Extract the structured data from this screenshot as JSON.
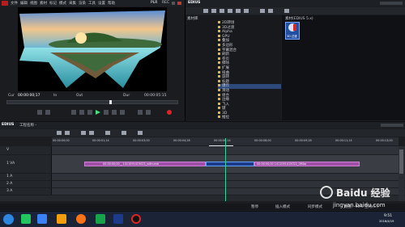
{
  "player": {
    "menu": [
      "文件",
      "编辑",
      "视图",
      "素材",
      "标记",
      "模式",
      "采集",
      "渲染",
      "工具",
      "设置",
      "帮助"
    ],
    "plr_label": "PLR",
    "rec_label": "REC",
    "cur_timecode": "00:00:00;17",
    "in_label": "In",
    "out_label": "Out",
    "dur_label": "Dur",
    "dur_value": "00:00:05:15"
  },
  "bin": {
    "title": "EDIUS",
    "tab": "素材库",
    "tree_items": [
      "2D转场",
      "3D过渡",
      "Alpha",
      "GPU",
      "叠加",
      "多边形",
      "字幕混合",
      "刷新",
      "卷页",
      "擦除",
      "扩展",
      "扭曲",
      "旋转",
      "标题",
      "爆炸",
      "滑动",
      "组合",
      "边缘",
      "飞入",
      "键",
      "3D",
      "推拉",
      "翻转",
      "选择"
    ],
    "thumb_title": "素材(EDIUS 5.x)",
    "thumb_label": "3D 过渡"
  },
  "timeline": {
    "title": "EDIUS",
    "seq_name": "工程名称 - ",
    "ruler": [
      "00:00:00;00",
      "00:00:01;14",
      "00:00:03;00",
      "00:00:04;28",
      "00:00:06;14",
      "00:00:08;00",
      "00:00:09;28",
      "00:00:11;14",
      "00:00:13;00"
    ],
    "playhead_time": "00:00:07;24",
    "tracks": [
      "V",
      "1 VA",
      "1 A",
      "2 A",
      "3 A"
    ],
    "clip_a": "00:00:00;00 _ 1411091415023_withumb",
    "clip_b": "00:00:00;00 1411091415022_0MAa",
    "status_left": "暂停",
    "status_items": [
      "插入模式",
      "同步模式",
      "磁盘：98% 空闲(C:)"
    ]
  },
  "taskbar": {
    "time": "9:51",
    "date": "2016/4/19"
  },
  "watermark": {
    "brand": "Baidu 经验",
    "url": "jingyan.baidu.com"
  }
}
